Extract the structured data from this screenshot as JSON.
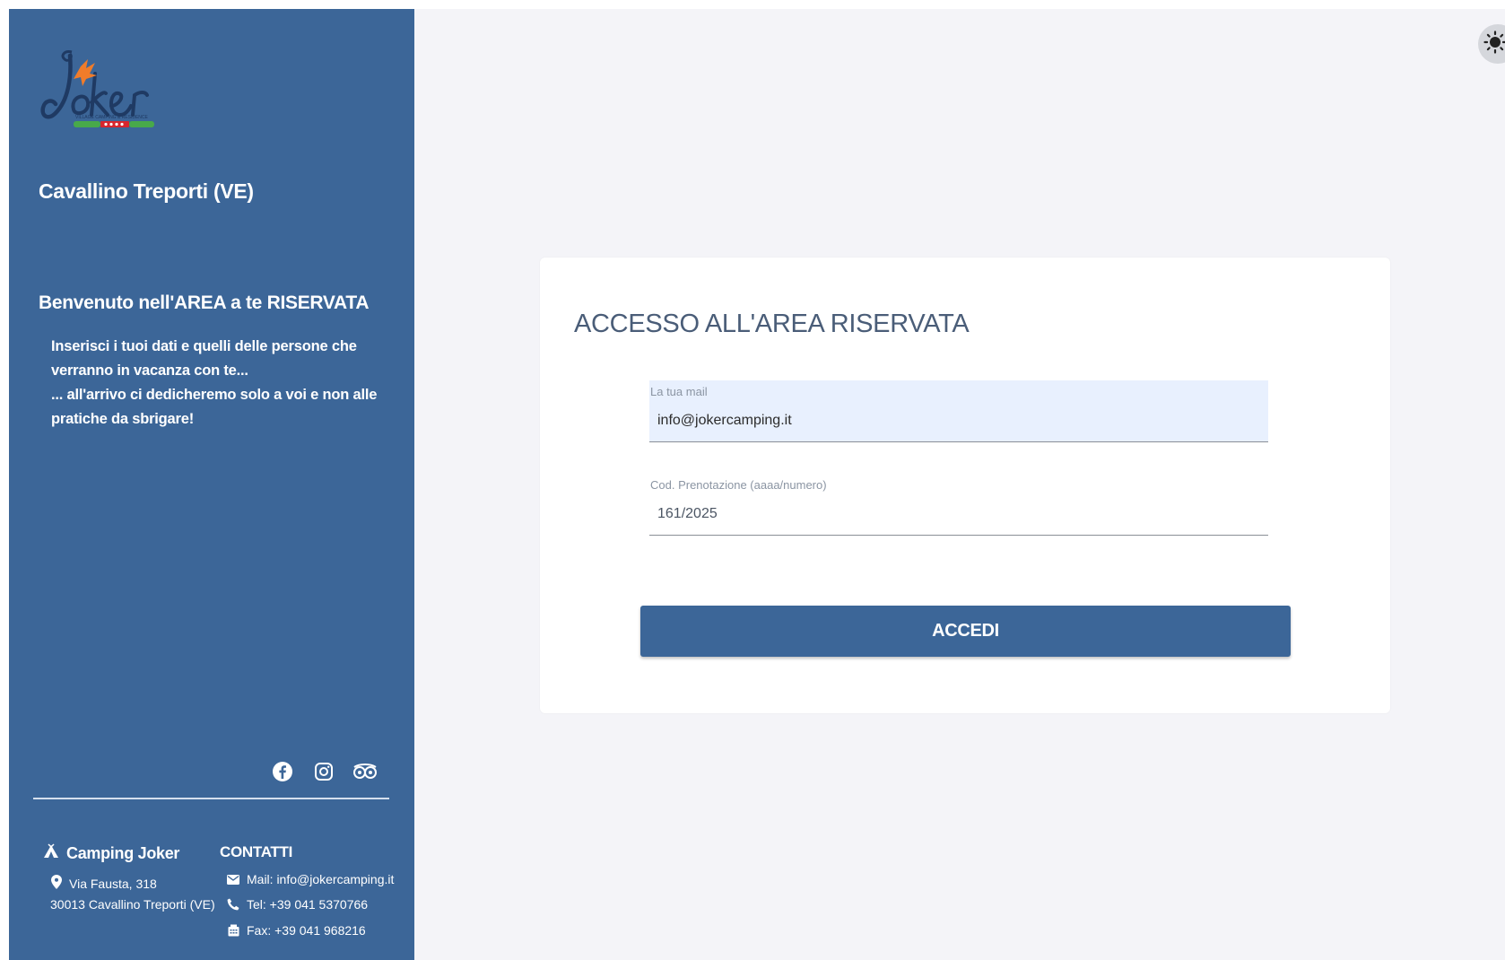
{
  "sidebar": {
    "brand": {
      "name": "Joker",
      "tagline": "VILLAGE CAMPING & RESIDENCE"
    },
    "location": "Cavallino Treporti (VE)",
    "welcome_title": "Benvenuto nell'AREA a te RISERVATA",
    "welcome_line1": "Inserisci i tuoi dati e quelli delle persone che verranno in vacanza con te...",
    "welcome_line2": "... all'arrivo ci dedicheremo solo a voi e non alle pratiche da sbrigare!",
    "social": [
      "facebook-icon",
      "instagram-icon",
      "tripadvisor-icon"
    ],
    "footer": {
      "camp_name": "Camping Joker",
      "address_line1": "Via Fausta, 318",
      "address_line2": "30013 Cavallino Treporti (VE)",
      "contacts_title": "CONTATTI",
      "mail": "Mail: info@jokercamping.it",
      "tel": "Tel: +39 041 5370766",
      "fax": "Fax: +39 041 968216"
    }
  },
  "login": {
    "title": "ACCESSO ALL'AREA RISERVATA",
    "email_label": "La tua mail",
    "email_value": "info@jokercamping.it",
    "code_label": "Cod. Prenotazione (aaaa/numero)",
    "code_value": "161/2025",
    "submit_label": "ACCEDI"
  },
  "theme_toggle": {
    "icon": "sun-icon"
  },
  "colors": {
    "sidebar": "#3c6698",
    "background": "#f4f4f8",
    "autofill": "#e8f0fe",
    "title": "#4a5d78",
    "logo_orange": "#f07c2a",
    "logo_green": "#48a94a",
    "logo_red": "#d7262e"
  }
}
